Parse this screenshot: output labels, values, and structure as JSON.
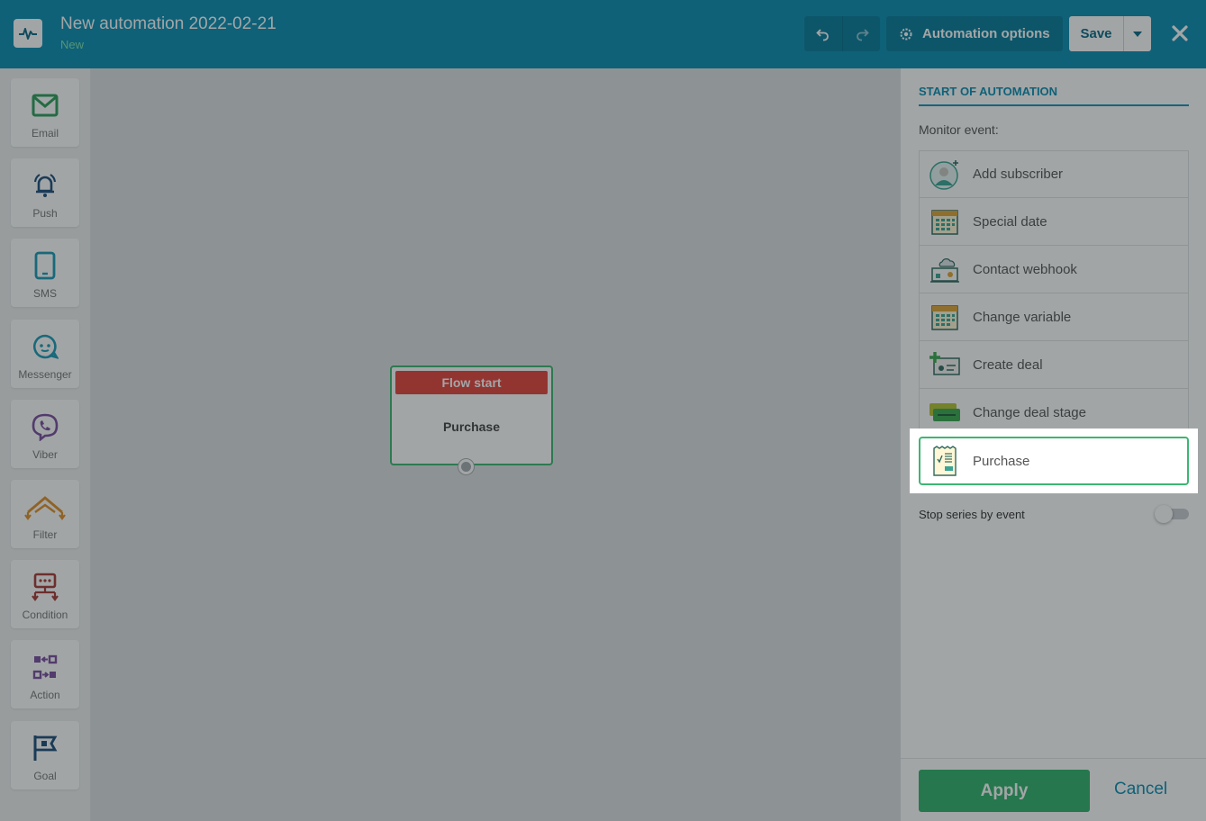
{
  "header": {
    "title": "New automation 2022-02-21",
    "status": "New",
    "options_label": "Automation options",
    "save_label": "Save"
  },
  "toolbox": [
    {
      "label": "Email",
      "icon": "envelope-icon",
      "color": "#2e9e5c"
    },
    {
      "label": "Push",
      "icon": "bell-icon",
      "color": "#1d4f7c"
    },
    {
      "label": "SMS",
      "icon": "phone-icon",
      "color": "#1a9bb8"
    },
    {
      "label": "Messenger",
      "icon": "chat-bubble-icon",
      "color": "#1a9bb8"
    },
    {
      "label": "Viber",
      "icon": "viber-icon",
      "color": "#7b4fa0"
    },
    {
      "label": "Filter",
      "icon": "filter-branch-icon",
      "color": "#e0922a"
    },
    {
      "label": "Condition",
      "icon": "condition-icon",
      "color": "#a73b36"
    },
    {
      "label": "Action",
      "icon": "action-icon",
      "color": "#7b4fa0"
    },
    {
      "label": "Goal",
      "icon": "goal-flag-icon",
      "color": "#1d4f7c"
    }
  ],
  "canvas": {
    "node": {
      "header": "Flow start",
      "event": "Purchase"
    }
  },
  "panel": {
    "title": "START OF AUTOMATION",
    "monitor_label": "Monitor event:",
    "events": [
      {
        "label": "Add subscriber",
        "icon": "add-subscriber-icon"
      },
      {
        "label": "Special date",
        "icon": "calendar-icon"
      },
      {
        "label": "Contact webhook",
        "icon": "webhook-icon"
      },
      {
        "label": "Change variable",
        "icon": "calendar-icon"
      },
      {
        "label": "Create deal",
        "icon": "create-deal-icon"
      },
      {
        "label": "Change deal stage",
        "icon": "deal-stage-icon"
      },
      {
        "label": "Purchase",
        "icon": "receipt-icon",
        "selected": true
      }
    ],
    "stop_series_label": "Stop series by event",
    "stop_series_enabled": false,
    "apply_label": "Apply",
    "cancel_label": "Cancel"
  },
  "colors": {
    "header": "#0a8eb3",
    "accent_green": "#31b26c",
    "flow_start_red": "#e5453d"
  }
}
